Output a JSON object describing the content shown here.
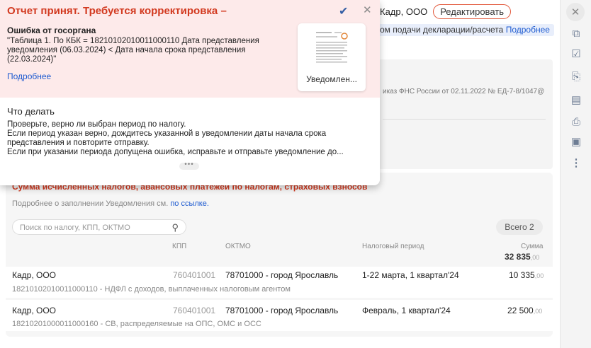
{
  "popup": {
    "title": "Отчет принят. Требуется корректировка –",
    "error_title": "Ошибка от госоргана",
    "error_text": "\"Таблица 1. По КБК = 18210102010011000110 Дата представления уведомления (06.03.2024) < Дата начала срока представления (22.03.2024)\"",
    "more_link": "Подробнее",
    "attachment_label": "Уведомлен...",
    "todo_title": "Что делать",
    "todo_text": "Проверьте, верно ли выбран период по налогу.\nЕсли период указан верно, дождитесь указанной в уведомлении даты начала срока представления и повторите отправку.\nЕсли при указании периода допущена ошибка, исправьте и отправьте уведомление до...",
    "expand_dots": "•••"
  },
  "header": {
    "org": "Кадр, ООО",
    "edit_label": "Редактировать"
  },
  "info_strip": {
    "text": "ом подачи декларации/расчета",
    "link": "Подробнее"
  },
  "order_text": "иказ ФНС России от 02.11.2022 № ЕД-7-8/1047@",
  "section": {
    "title": "Сумма исчисленных налогов, авансовых платежей по налогам, страховых взносов",
    "hint_text": "Подробнее о заполнении Уведомления см.",
    "hint_link": "по ссылке.",
    "search_placeholder": "Поиск по налогу, КПП, ОКТМО",
    "total_label": "Всего 2"
  },
  "table": {
    "headers": {
      "kpp": "КПП",
      "oktmo": "ОКТМО",
      "period": "Налоговый период",
      "sum": "Сумма"
    },
    "sum_total_int": "32 835",
    "sum_total_frac": ",00",
    "rows": [
      {
        "org": "Кадр, ООО",
        "kpp": "760401001",
        "oktmo": "78701000 - город Ярославль",
        "period": "1-22 марта, 1 квартал'24",
        "sum_int": "10 335",
        "sum_frac": ",00",
        "kbk": "18210102010011000110 - НДФЛ с доходов, выплаченных налоговым агентом"
      },
      {
        "org": "Кадр, ООО",
        "kpp": "760401001",
        "oktmo": "78701000 - город Ярославль",
        "period": "Февраль, 1 квартал'24",
        "sum_int": "22 500",
        "sum_frac": ",00",
        "kbk": "18210201000011000160 - СВ, распределяемые на ОПС, ОМС и ОСС"
      }
    ]
  },
  "right_bar": [
    "close-icon",
    "copy-icon",
    "checklist-icon",
    "paperclip-icon",
    "clipboard-icon",
    "printer-icon",
    "save-icon",
    "more-icon"
  ]
}
